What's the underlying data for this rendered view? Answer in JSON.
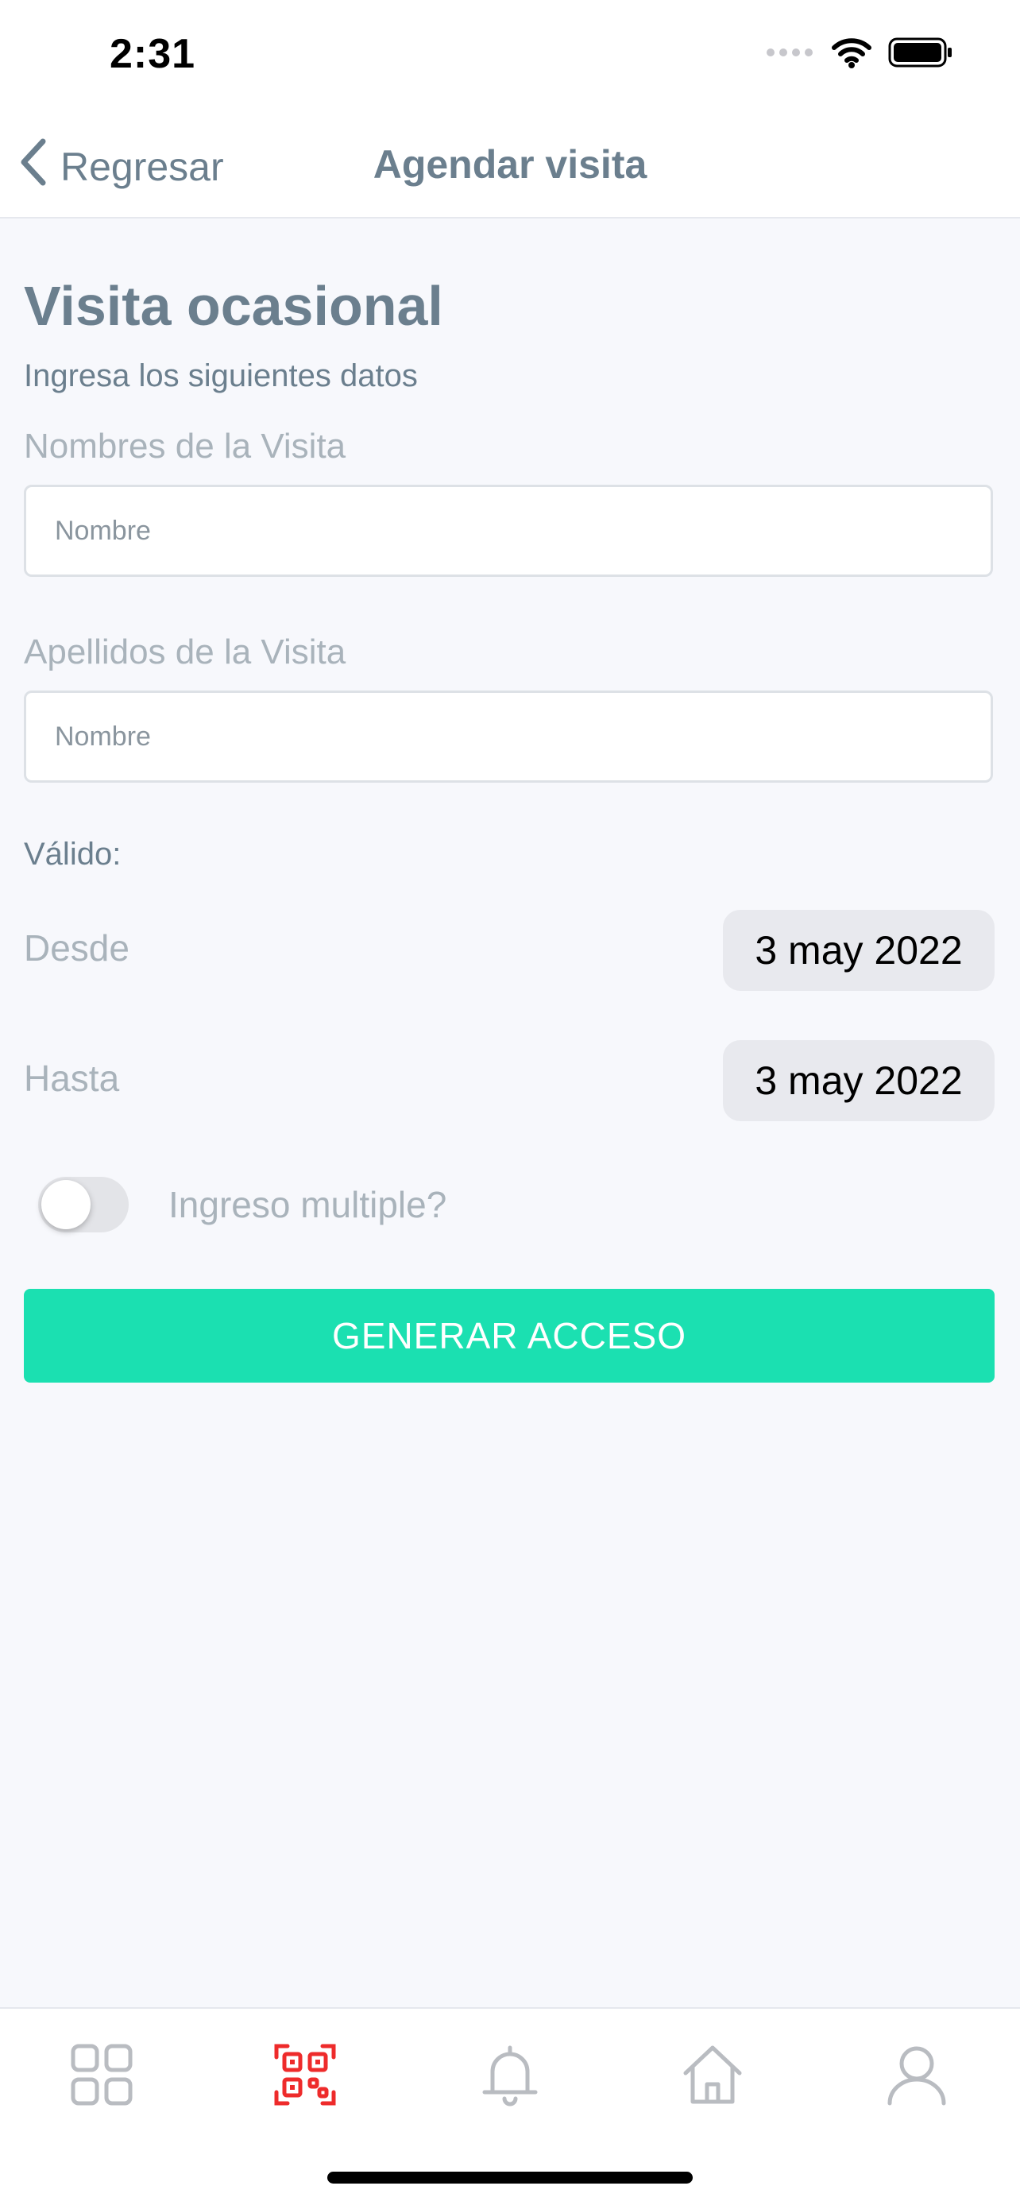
{
  "status_bar": {
    "time": "2:31"
  },
  "nav": {
    "back_label": "Regresar",
    "title": "Agendar visita"
  },
  "form": {
    "title": "Visita ocasional",
    "subtitle": "Ingresa los siguientes datos",
    "first_name": {
      "label": "Nombres de la Visita",
      "placeholder": "Nombre",
      "value": ""
    },
    "last_name": {
      "label": "Apellidos de la Visita",
      "placeholder": "Nombre",
      "value": ""
    },
    "valid_label": "Válido:",
    "from": {
      "label": "Desde",
      "value": "3 may 2022"
    },
    "to": {
      "label": "Hasta",
      "value": "3 may 2022"
    },
    "multiple_entry": {
      "label": "Ingreso multiple?",
      "on": false
    },
    "submit_label": "GENERAR ACCESO"
  },
  "tab_bar": {
    "items": [
      {
        "icon": "grid-icon",
        "active": false
      },
      {
        "icon": "qr-code-icon",
        "active": true
      },
      {
        "icon": "bell-icon",
        "active": false
      },
      {
        "icon": "home-icon",
        "active": false
      },
      {
        "icon": "user-icon",
        "active": false
      }
    ]
  },
  "colors": {
    "accent": "#1be0b1",
    "active_tab": "#ee2b2b",
    "inactive_tab": "#b9bcc1",
    "heading": "#6b7f8e",
    "muted_label": "#a9b3bb",
    "background": "#f7f8fc"
  }
}
